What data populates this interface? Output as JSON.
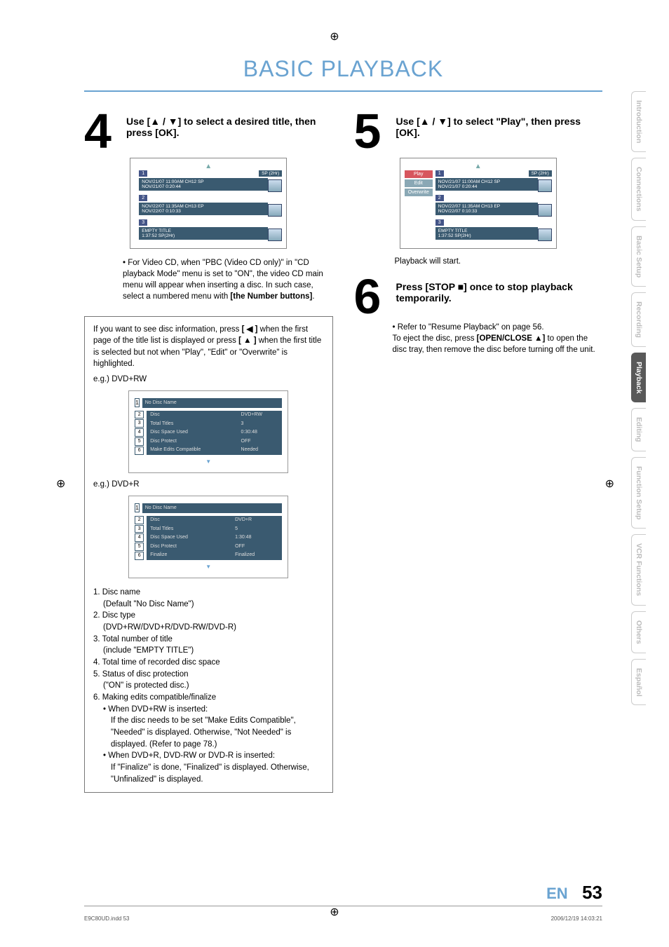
{
  "register_mark": "⊕",
  "title": "BASIC PLAYBACK",
  "step4": {
    "num": "4",
    "heading_a": "Use [",
    "heading_b": " / ",
    "heading_c": "] to select a desired title, then press [OK].",
    "screenshot": {
      "sp": "SP (2Hr)",
      "items": [
        {
          "n": "1",
          "line1": "NOV/21/07  11:00AM CH12  SP",
          "line2": "NOV/21/07   0:20:44"
        },
        {
          "n": "2",
          "line1": "NOV/22/07  11:35AM CH13  EP",
          "line2": "NOV/22/07   0:10:33"
        },
        {
          "n": "3",
          "line1": "EMPTY TITLE",
          "line2": "1:37:52  SP(2Hr)"
        }
      ]
    },
    "note": "For Video CD, when \"PBC (Video CD only)\" in \"CD playback Mode\" menu is set to \"ON\", the video CD main menu will appear when inserting a disc. In such case, select a numbered menu with ",
    "note_bold": "[the Number buttons]",
    "note_tail": "."
  },
  "step5": {
    "num": "5",
    "heading_a": "Use [",
    "heading_b": " / ",
    "heading_c": "] to select \"Play\", then press [OK].",
    "sidebar": [
      "Play",
      "Edit",
      "Overwrite"
    ],
    "after": "Playback will start."
  },
  "step6": {
    "num": "6",
    "heading_a": "Press [STOP ",
    "heading_b": "] once to stop playback temporarily.",
    "body1": "Refer to \"Resume Playback\" on page 56.",
    "body2a": "To eject the disc, press ",
    "body2b": "[OPEN/CLOSE ",
    "body2c": "]",
    "body2d": " to open the disc tray, then remove the disc before turning off the unit."
  },
  "info_box": {
    "intro_a": "If you want to see disc information, press ",
    "intro_b": "[ ◀ ]",
    "intro_c": " when the first page of the title list is displayed or press ",
    "intro_d": "[ ▲ ]",
    "intro_e": " when the first title is selected but not when \"Play\", \"Edit\" or \"Overwrite\" is highlighted.",
    "eg_rw": "e.g.) DVD+RW",
    "eg_r": "e.g.) DVD+R",
    "header_badge": "1",
    "header_text": "No Disc Name",
    "rw": {
      "rows": [
        [
          "Disc",
          "DVD+RW"
        ],
        [
          "Total Titles",
          "3"
        ],
        [
          "Disc Space Used",
          "0:30:48"
        ],
        [
          "Disc Protect",
          "OFF"
        ],
        [
          "Make Edits Compatible",
          "Needed"
        ]
      ]
    },
    "r": {
      "rows": [
        [
          "Disc",
          "DVD+R"
        ],
        [
          "Total Titles",
          "5"
        ],
        [
          "Disc Space Used",
          "1:30:48"
        ],
        [
          "Disc Protect",
          "OFF"
        ],
        [
          "Finalize",
          "Finalized"
        ]
      ]
    },
    "legend": [
      "1. Disc name",
      "(Default \"No Disc Name\")",
      "2. Disc type",
      "(DVD+RW/DVD+R/DVD-RW/DVD-R)",
      "3. Total number of title",
      "(include \"EMPTY TITLE\")",
      "4. Total time of recorded disc space",
      "5. Status of disc protection",
      "(\"ON\" is protected disc.)",
      "6. Making edits compatible/finalize",
      "• When DVD+RW is inserted:",
      "If the disc needs to be set \"Make Edits Compatible\", \"Needed\" is displayed. Otherwise, \"Not Needed\" is displayed. (Refer to page 78.)",
      "• When DVD+R, DVD-RW or DVD-R is inserted:",
      "If \"Finalize\" is done, \"Finalized\"  is displayed. Otherwise, \"Unfinalized\" is displayed."
    ]
  },
  "tabs": [
    "Introduction",
    "Connections",
    "Basic Setup",
    "Recording",
    "Playback",
    "Editing",
    "Function Setup",
    "VCR Functions",
    "Others",
    "Español"
  ],
  "active_tab": "Playback",
  "page_lang": "EN",
  "page_num": "53",
  "footer_left": "E9C80UD.indd   53",
  "footer_right": "2006/12/19   14:03:21"
}
